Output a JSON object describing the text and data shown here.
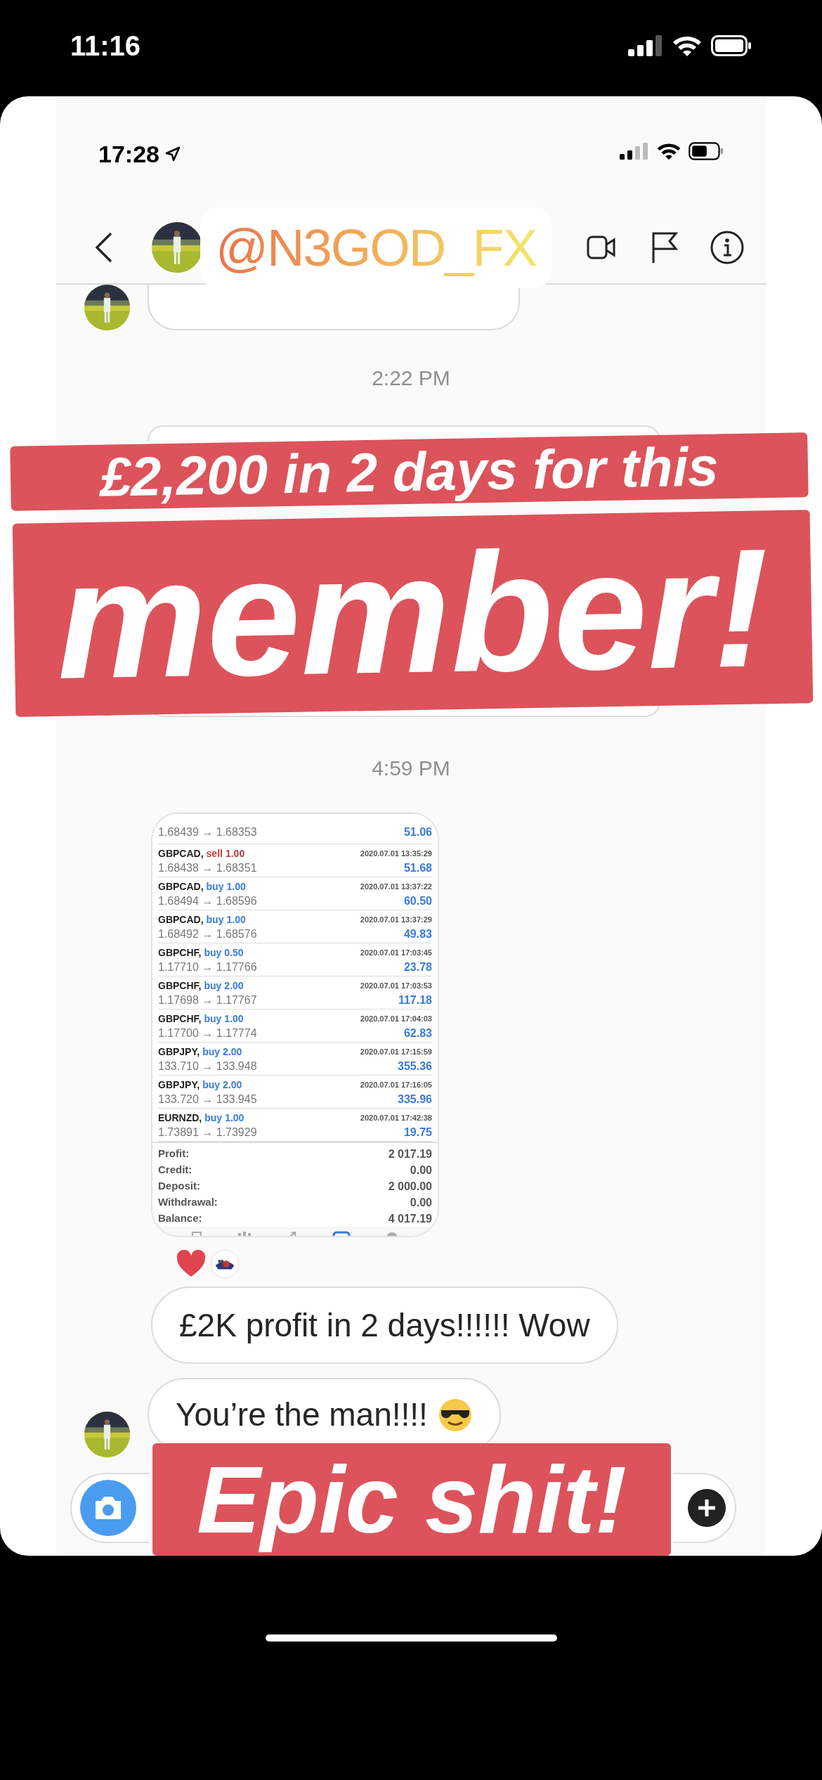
{
  "device_status": {
    "time": "11:16"
  },
  "screenshot": {
    "status_time": "17:28",
    "timestamps": [
      "2:22 PM",
      "4:59 PM"
    ],
    "trade_history": {
      "partial_row": {
        "prices": "1.68439 → 1.68353",
        "profit": "51.06"
      },
      "rows": [
        {
          "symbol": "GBPCAD,",
          "side": "sell",
          "volume": "1.00",
          "time": "2020.07.01 13:35:29",
          "prices": "1.68438 → 1.68351",
          "profit": "51.68"
        },
        {
          "symbol": "GBPCAD,",
          "side": "buy",
          "volume": "1.00",
          "time": "2020.07.01 13:37:22",
          "prices": "1.68494 → 1.68596",
          "profit": "60.50"
        },
        {
          "symbol": "GBPCAD,",
          "side": "buy",
          "volume": "1.00",
          "time": "2020.07.01 13:37:29",
          "prices": "1.68492 → 1.68576",
          "profit": "49.83"
        },
        {
          "symbol": "GBPCHF,",
          "side": "buy",
          "volume": "0.50",
          "time": "2020.07.01 17:03:45",
          "prices": "1.17710 → 1.17766",
          "profit": "23.78"
        },
        {
          "symbol": "GBPCHF,",
          "side": "buy",
          "volume": "2.00",
          "time": "2020.07.01 17:03:53",
          "prices": "1.17698 → 1.17767",
          "profit": "117.18"
        },
        {
          "symbol": "GBPCHF,",
          "side": "buy",
          "volume": "1.00",
          "time": "2020.07.01 17:04:03",
          "prices": "1.17700 → 1.17774",
          "profit": "62.83"
        },
        {
          "symbol": "GBPJPY,",
          "side": "buy",
          "volume": "2.00",
          "time": "2020.07.01 17:15:59",
          "prices": "133.710 → 133.948",
          "profit": "355.36"
        },
        {
          "symbol": "GBPJPY,",
          "side": "buy",
          "volume": "2.00",
          "time": "2020.07.01 17:16:05",
          "prices": "133.720 → 133.945",
          "profit": "335.96"
        },
        {
          "symbol": "EURNZD,",
          "side": "buy",
          "volume": "1.00",
          "time": "2020.07.01 17:42:38",
          "prices": "1.73891 → 1.73929",
          "profit": "19.75"
        }
      ],
      "summary": [
        {
          "label": "Profit:",
          "value": "2 017.19"
        },
        {
          "label": "Credit:",
          "value": "0.00"
        },
        {
          "label": "Deposit:",
          "value": "2 000.00"
        },
        {
          "label": "Withdrawal:",
          "value": "0.00"
        },
        {
          "label": "Balance:",
          "value": "4 017.19"
        }
      ]
    },
    "messages": [
      {
        "text": "£2K profit in 2 days!!!!!! Wow"
      },
      {
        "text": "You’re the man!!!!"
      }
    ]
  },
  "stickers": {
    "mention": "@N3GOD_FX",
    "headline_1": "£2,200 in 2 days for this",
    "headline_2": "member!",
    "footer": "Epic shit!"
  }
}
